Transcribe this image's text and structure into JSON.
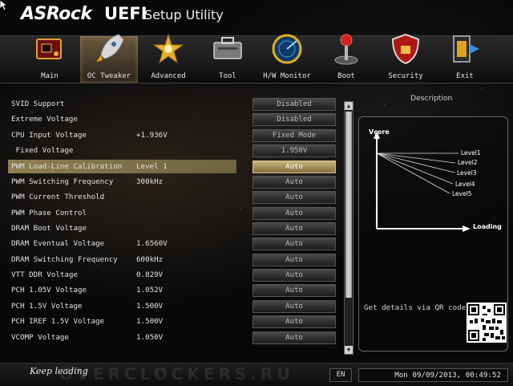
{
  "header": {
    "brand": "ASRock",
    "uefi": "UEFI",
    "subtitle": "Setup Utility"
  },
  "nav": {
    "active": "OC Tweaker",
    "items": [
      {
        "label": "Main",
        "icon": "motherboard-icon"
      },
      {
        "label": "OC Tweaker",
        "icon": "rocket-icon"
      },
      {
        "label": "Advanced",
        "icon": "star-burst-icon"
      },
      {
        "label": "Tool",
        "icon": "toolbox-icon"
      },
      {
        "label": "H/W Monitor",
        "icon": "radar-icon"
      },
      {
        "label": "Boot",
        "icon": "joystick-icon"
      },
      {
        "label": "Security",
        "icon": "shield-icon"
      },
      {
        "label": "Exit",
        "icon": "exit-door-icon"
      }
    ]
  },
  "settings": [
    {
      "name": "SVID Support",
      "value": "",
      "option": "Disabled"
    },
    {
      "name": "Extreme Voltage",
      "value": "",
      "option": "Disabled"
    },
    {
      "name": "CPU Input Voltage",
      "value": "+1.936V",
      "option": "Fixed Mode"
    },
    {
      "name": " Fixed Voltage",
      "value": "",
      "option": "1.950V"
    },
    {
      "name": "PWM Load-Line Calibration",
      "value": "Level 1",
      "option": "Auto"
    },
    {
      "name": "PWM Switching Frequency",
      "value": "300kHz",
      "option": "Auto"
    },
    {
      "name": "PWM Current Threshold",
      "value": "",
      "option": "Auto"
    },
    {
      "name": "PWM Phase Control",
      "value": "",
      "option": "Auto"
    },
    {
      "name": "DRAM Boot Voltage",
      "value": "",
      "option": "Auto"
    },
    {
      "name": "DRAM Eventual Voltage",
      "value": "1.6560V",
      "option": "Auto"
    },
    {
      "name": "DRAM Switching Frequency",
      "value": "600kHz",
      "option": "Auto"
    },
    {
      "name": "VTT DDR Voltage",
      "value": "0.829V",
      "option": "Auto"
    },
    {
      "name": "PCH 1.05V Voltage",
      "value": "1.052V",
      "option": "Auto"
    },
    {
      "name": "PCH 1.5V Voltage",
      "value": "1.500V",
      "option": "Auto"
    },
    {
      "name": "PCH IREF 1.5V Voltage",
      "value": "1.500V",
      "option": "Auto"
    },
    {
      "name": "VCOMP Voltage",
      "value": "1.050V",
      "option": "Auto"
    }
  ],
  "selected_index": 4,
  "description": {
    "title": "Description",
    "diagram": {
      "y_label": "Vcore",
      "x_label": "Loading",
      "levels": [
        "Level1",
        "Level2",
        "Level3",
        "Level4",
        "Level5"
      ]
    },
    "qr_text": "Get details via QR code"
  },
  "footer": {
    "tagline": "Keep leading",
    "watermark": "OVERCLOCKERS.RU",
    "language": "EN",
    "datetime": "Mon 09/09/2013, 00:49:52"
  },
  "colors": {
    "highlight": "#8e7f50",
    "active_button": "#b4a26c",
    "nav_active": "#5a4c36"
  }
}
